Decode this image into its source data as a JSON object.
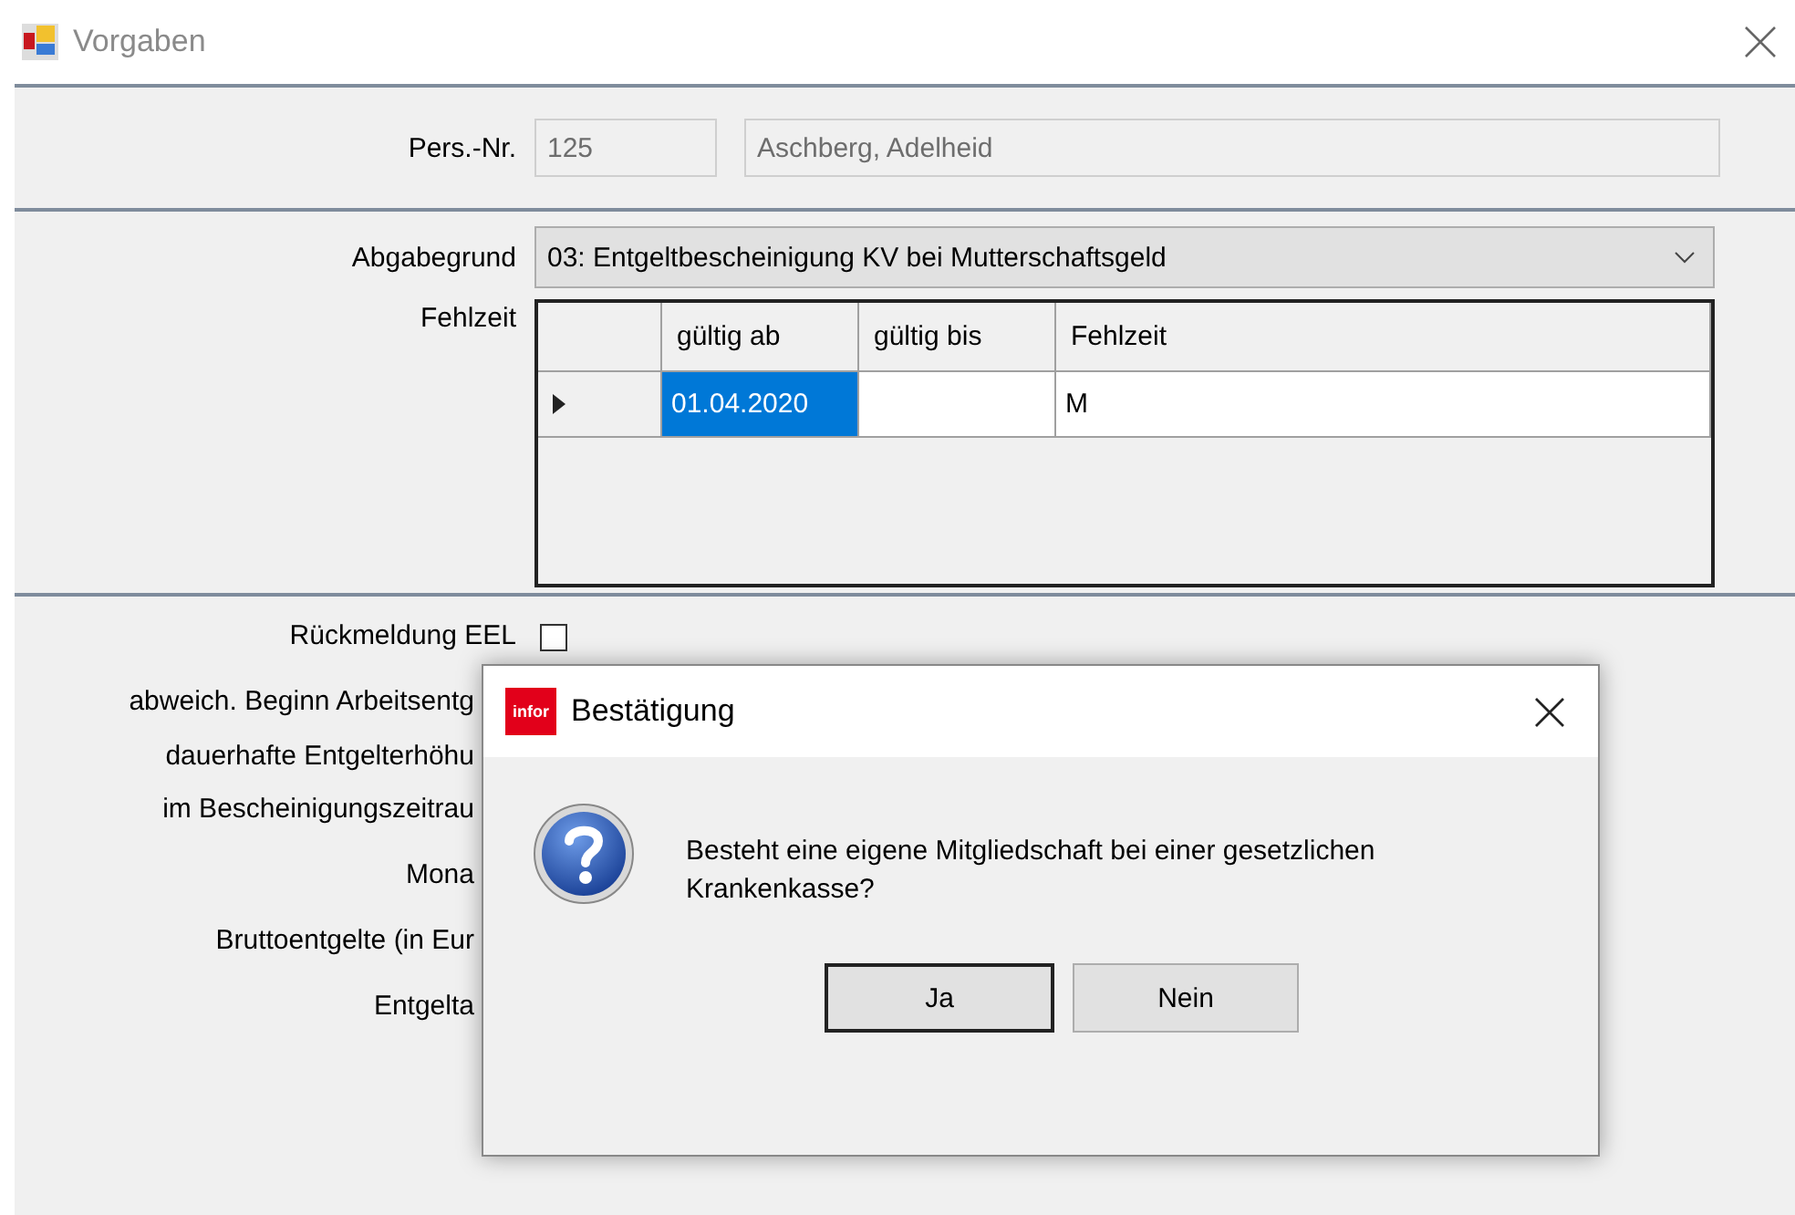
{
  "window": {
    "title": "Vorgaben"
  },
  "person": {
    "label": "Pers.-Nr.",
    "number": "125",
    "name": "Aschberg, Adelheid"
  },
  "reason": {
    "label": "Abgabegrund",
    "value": "03: Entgeltbescheinigung KV bei Mutterschaftsgeld"
  },
  "absence": {
    "label": "Fehlzeit",
    "columns": [
      "gültig ab",
      "gültig bis",
      "Fehlzeit"
    ],
    "rows": [
      {
        "current": true,
        "cells": [
          {
            "text": "01.04.2020",
            "selected": true
          },
          {
            "selected": false
          },
          {
            "text": "M",
            "selected": false
          }
        ]
      }
    ]
  },
  "feedback": {
    "label": "Rückmeldung EEL",
    "checked": false
  },
  "partial_labels": [
    "abweich. Beginn Arbeitsentg",
    "dauerhafte Entgelterhöhu",
    "im Bescheinigungszeitrau",
    "Mona",
    "Bruttoentgelte (in Eur",
    "Entgelta"
  ],
  "dialog": {
    "title": "Bestätigung",
    "logo": "infor",
    "message": "Besteht eine eigene Mitgliedschaft bei einer gesetzlichen Krankenkasse?",
    "buttons": [
      {
        "label": "Ja",
        "default": true
      },
      {
        "label": "Nein",
        "default": false
      }
    ]
  }
}
